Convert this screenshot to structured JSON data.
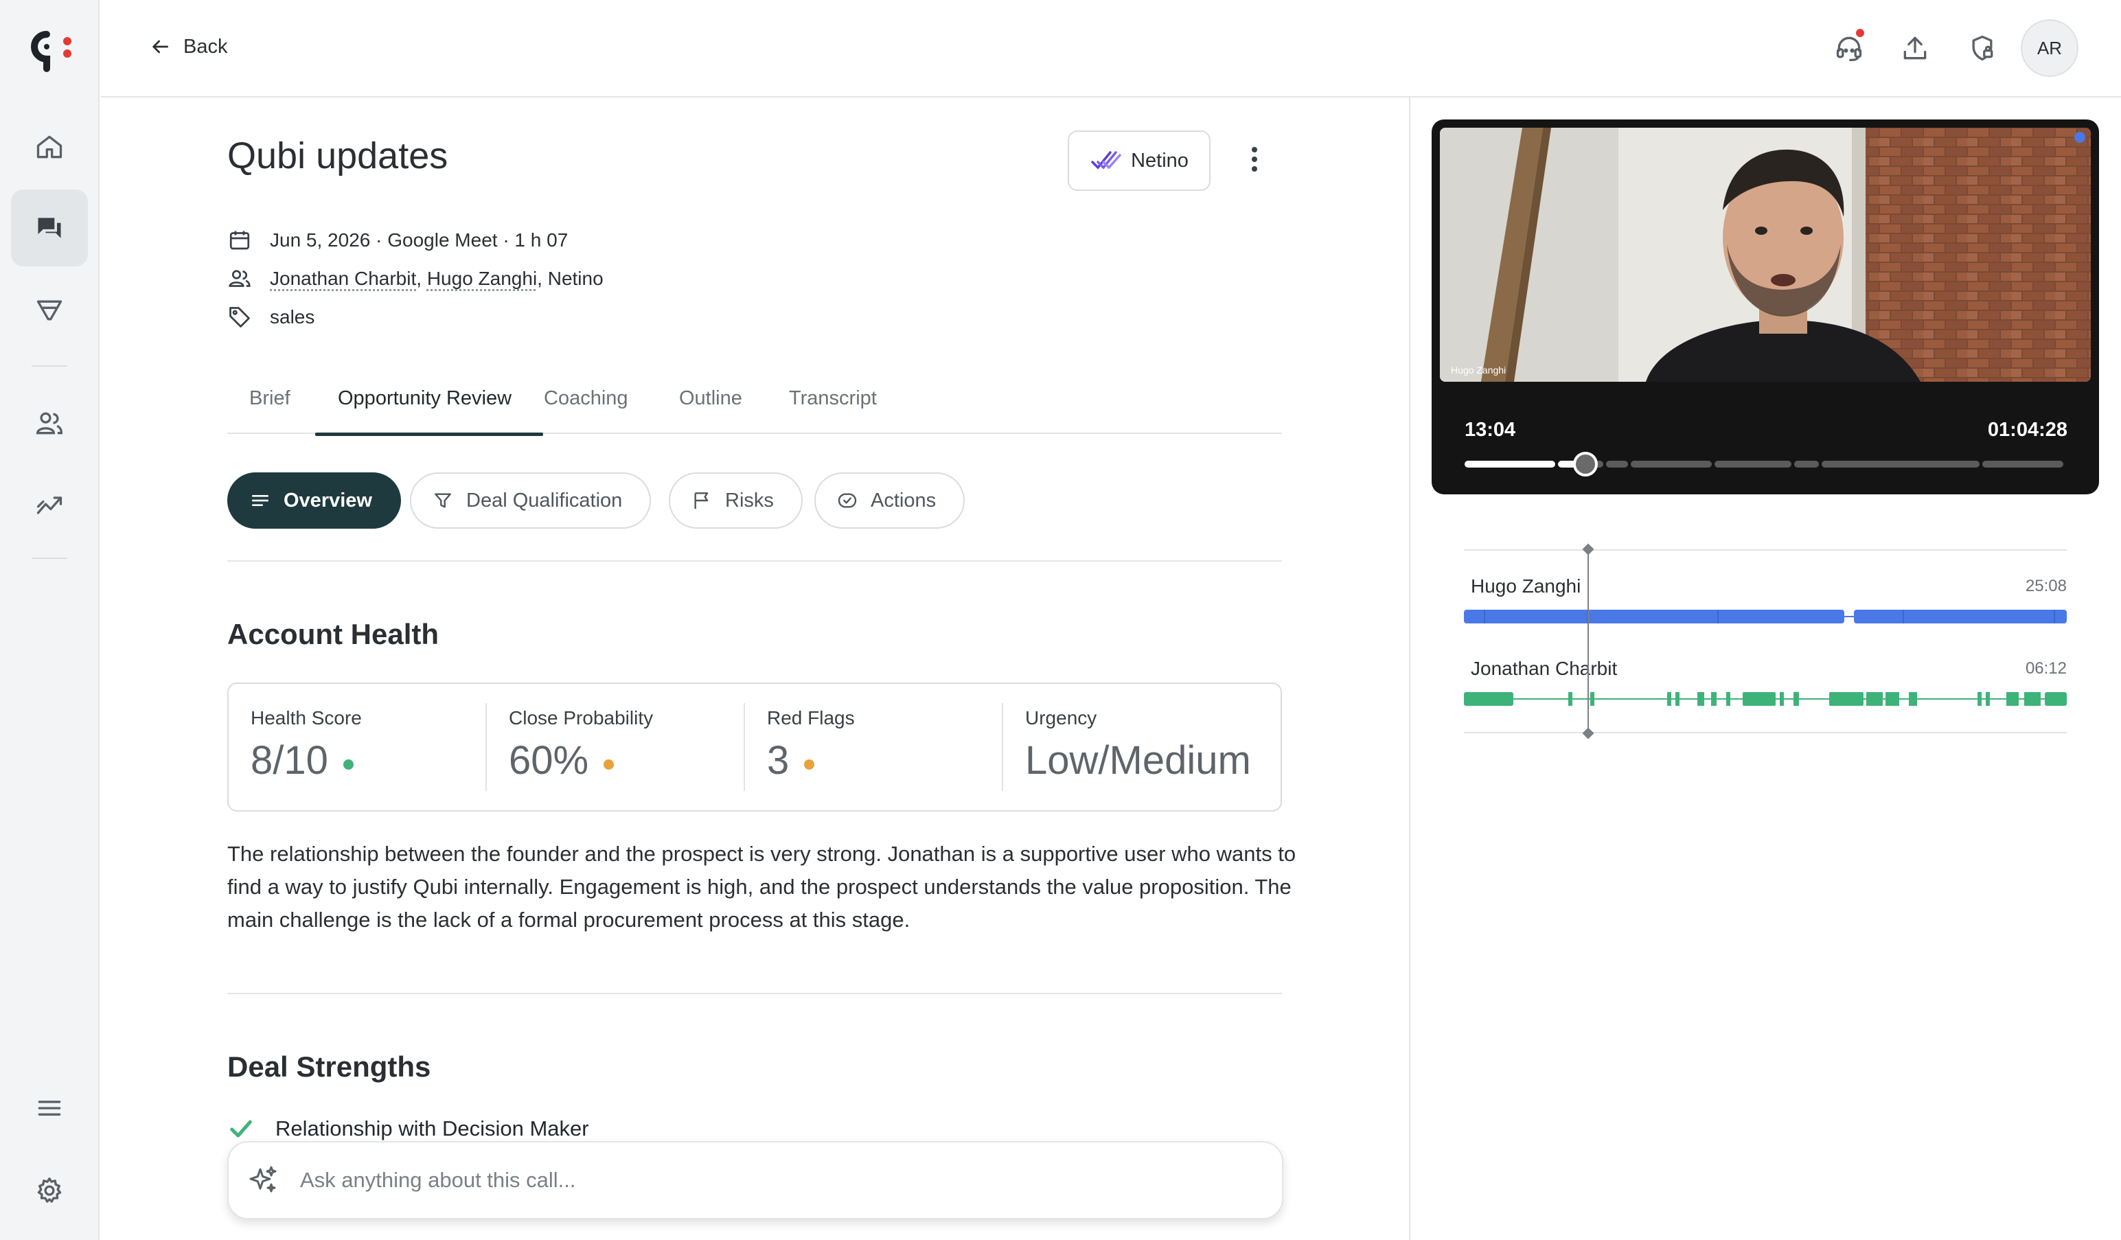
{
  "nav": {
    "back_label": "Back",
    "avatar_initials": "AR"
  },
  "call": {
    "title": "Qubi updates",
    "company": "Netino",
    "meta": "Jun 5, 2026 · Google Meet · 1 h 07",
    "participants": [
      "Jonathan Charbit",
      "Hugo Zanghi",
      "Netino"
    ],
    "tag": "sales"
  },
  "tabs": [
    "Brief",
    "Opportunity Review",
    "Coaching",
    "Outline",
    "Transcript"
  ],
  "active_tab": "Opportunity Review",
  "subtabs": [
    "Overview",
    "Deal Qualification",
    "Risks",
    "Actions"
  ],
  "active_subtab": "Overview",
  "account_health": {
    "title": "Account Health",
    "metrics": [
      {
        "label": "Health Score",
        "value": "8/10",
        "status": "green"
      },
      {
        "label": "Close Probability",
        "value": "60%",
        "status": "orange"
      },
      {
        "label": "Red Flags",
        "value": "3",
        "status": "orange"
      },
      {
        "label": "Urgency",
        "value": "Low/Medium",
        "status": "none"
      }
    ],
    "summary": "The relationship between the founder and the prospect is very strong. Jonathan is a supportive user who wants to find a way to justify Qubi internally. Engagement is high, and the prospect understands the value proposition. The main challenge is the lack of a formal procurement process at this stage."
  },
  "deal_strengths": {
    "title": "Deal Strengths",
    "items": [
      "Relationship with Decision Maker"
    ]
  },
  "ask": {
    "placeholder": "Ask anything about this call..."
  },
  "player": {
    "current_time": "13:04",
    "total_time": "01:04:28",
    "progress": 0.2,
    "video_label": "Hugo Zanghi"
  },
  "speakers": [
    {
      "name": "Hugo Zanghi",
      "duration": "25:08",
      "color": "#4a78e6"
    },
    {
      "name": "Jonathan Charbit",
      "duration": "06:12",
      "color": "#3db37a"
    }
  ],
  "colors": {
    "accent": "#1f3a3f",
    "status_green": "#3db37a",
    "status_orange": "#e9a23b",
    "notification": "#e53935"
  }
}
